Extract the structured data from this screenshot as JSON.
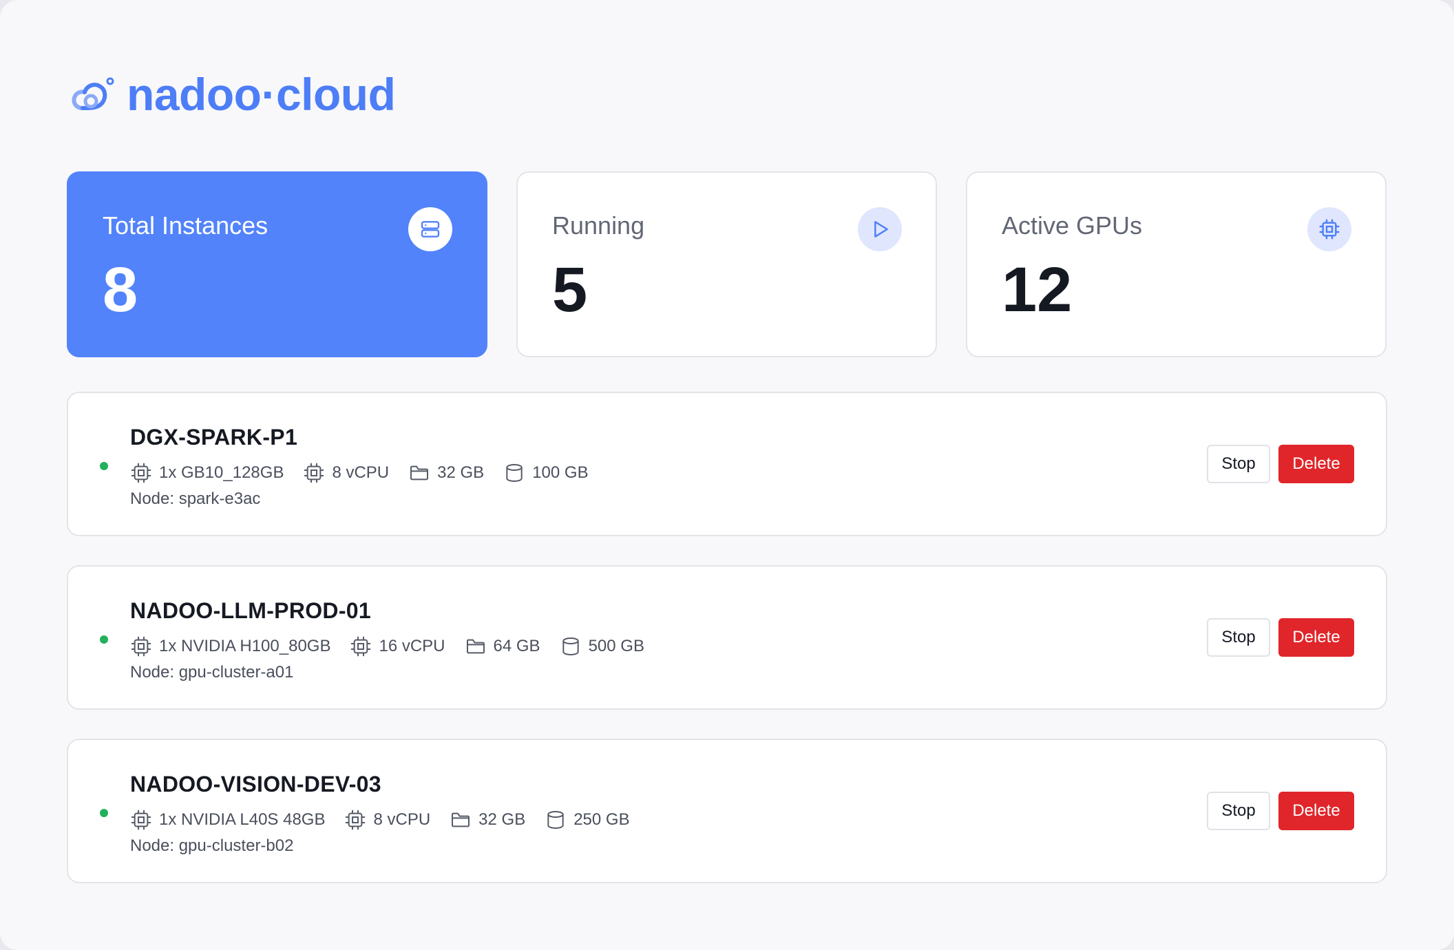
{
  "brand": {
    "name": "nadoo·cloud",
    "color": "#4d7ef7"
  },
  "stats": [
    {
      "label": "Total Instances",
      "value": "8",
      "icon": "server-icon"
    },
    {
      "label": "Running",
      "value": "5",
      "icon": "play-icon"
    },
    {
      "label": "Active GPUs",
      "value": "12",
      "icon": "chip-icon"
    }
  ],
  "instances": [
    {
      "name": "DGX-SPARK-P1",
      "status": "running",
      "gpu": "1x GB10_128GB",
      "cpu": "8 vCPU",
      "memory": "32 GB",
      "storage": "100 GB",
      "node": "Node: spark-e3ac",
      "stop_label": "Stop",
      "delete_label": "Delete"
    },
    {
      "name": "NADOO-LLM-PROD-01",
      "status": "running",
      "gpu": "1x NVIDIA H100_80GB",
      "cpu": "16 vCPU",
      "memory": "64 GB",
      "storage": "500 GB",
      "node": "Node: gpu-cluster-a01",
      "stop_label": "Stop",
      "delete_label": "Delete"
    },
    {
      "name": "NADOO-VISION-DEV-03",
      "status": "running",
      "gpu": "1x NVIDIA L40S 48GB",
      "cpu": "8 vCPU",
      "memory": "32 GB",
      "storage": "250 GB",
      "node": "Node: gpu-cluster-b02",
      "stop_label": "Stop",
      "delete_label": "Delete"
    }
  ],
  "colors": {
    "primary": "#5283fb",
    "danger": "#e0262a",
    "status_running": "#22b05a"
  }
}
